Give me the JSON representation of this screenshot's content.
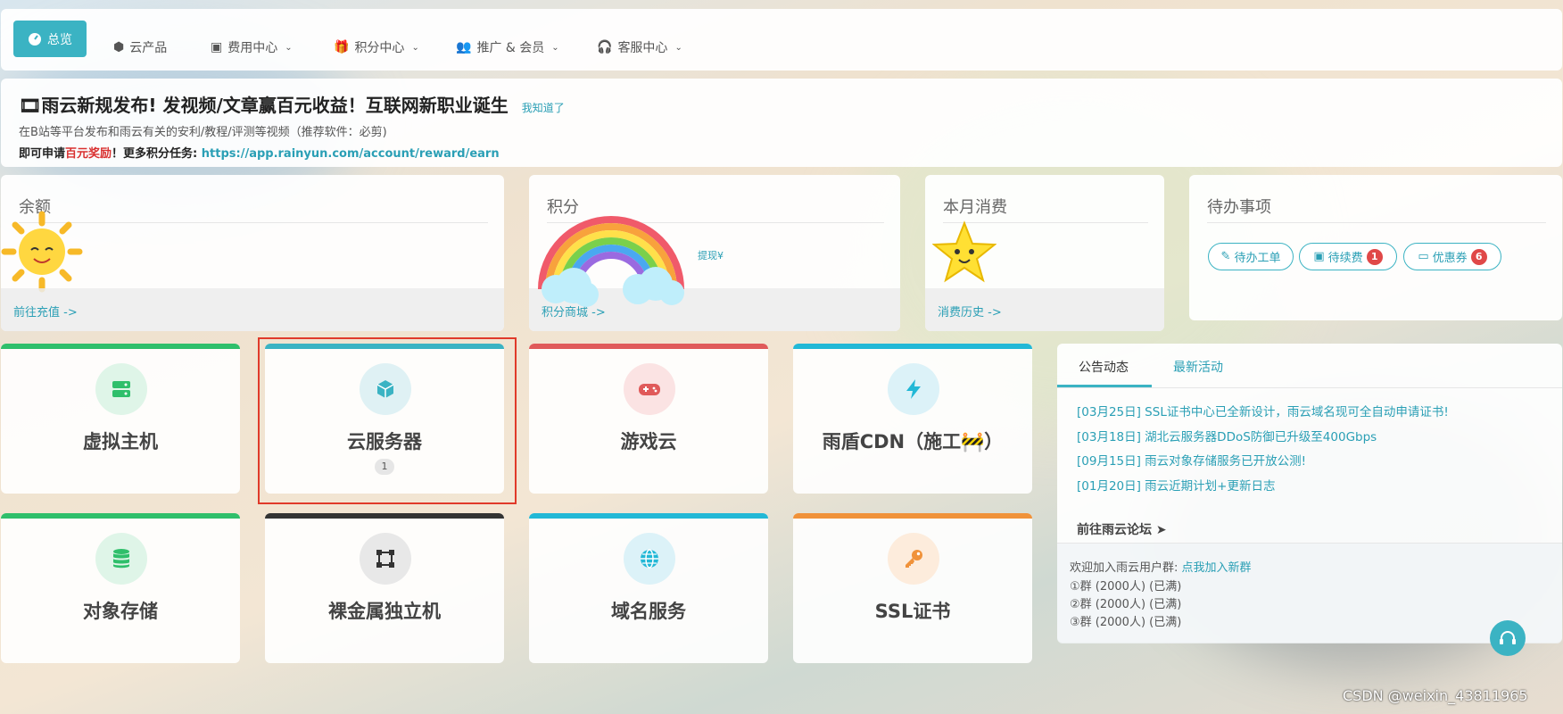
{
  "nav": {
    "items": [
      {
        "label": "总览",
        "icon": "dashboard-icon"
      },
      {
        "label": "云产品",
        "icon": "cubes-icon"
      },
      {
        "label": "费用中心",
        "icon": "money-icon"
      },
      {
        "label": "积分中心",
        "icon": "gift-icon"
      },
      {
        "label": "推广 & 会员",
        "icon": "users-icon"
      },
      {
        "label": "客服中心",
        "icon": "headset-icon"
      }
    ]
  },
  "announce": {
    "title": "雨云新规发布! 发视频/文章赢百元收益！互联网新职业诞生",
    "know": "我知道了",
    "line2": "在B站等平台发布和雨云有关的安利/教程/评测等视频（推荐软件：必剪)",
    "line3_a": "即可申请",
    "line3_red": "百元奖励",
    "line3_b": "！更多积分任务: ",
    "line3_link": "https://app.rainyun.com/account/reward/earn"
  },
  "stats": {
    "balance": {
      "title": "余额",
      "foot": "前往充值 ->"
    },
    "points": {
      "title": "积分",
      "withdraw": "提现¥",
      "foot": "积分商城 ->"
    },
    "month": {
      "title": "本月消费",
      "foot": "消费历史 ->"
    },
    "todo": {
      "title": "待办事项",
      "pills": [
        {
          "label": "待办工单",
          "badge": ""
        },
        {
          "label": "待续费",
          "badge": "1"
        },
        {
          "label": "优惠券",
          "badge": "6"
        }
      ]
    }
  },
  "tiles": [
    {
      "name": "虚拟主机",
      "color": "#2fbf6b",
      "icon": "server-icon"
    },
    {
      "name": "云服务器",
      "color": "#3bb3c3",
      "icon": "cube-icon",
      "count": "1"
    },
    {
      "name": "游戏云",
      "color": "#e05a5a",
      "icon": "gamepad-icon"
    },
    {
      "name": "雨盾CDN（施工🚧）",
      "color": "#22b8d6",
      "icon": "bolt-icon"
    },
    {
      "name": "对象存储",
      "color": "#2fbf6b",
      "icon": "database-icon"
    },
    {
      "name": "裸金属独立机",
      "color": "#333333",
      "icon": "vector-square-icon"
    },
    {
      "name": "域名服务",
      "color": "#22b8d6",
      "icon": "globe-icon"
    },
    {
      "name": "SSL证书",
      "color": "#f0923a",
      "icon": "key-icon"
    }
  ],
  "news": {
    "tabs": [
      "公告动态",
      "最新活动"
    ],
    "items": [
      "[03月25日] SSL证书中心已全新设计，雨云域名现可全自动申请证书!",
      "[03月18日] 湖北云服务器DDoS防御已升级至400Gbps",
      "[09月15日] 雨云对象存储服务已开放公测!",
      "[01月20日] 雨云近期计划+更新日志"
    ],
    "forum": "前往雨云论坛",
    "group_intro": "欢迎加入雨云用户群: ",
    "group_link": "点我加入新群",
    "groups": [
      "①群 (2000人) (已满)",
      "②群 (2000人) (已满)",
      "③群 (2000人) (已满)"
    ]
  },
  "watermark": "CSDN @weixin_43811965",
  "accent": "#3bb3c3"
}
